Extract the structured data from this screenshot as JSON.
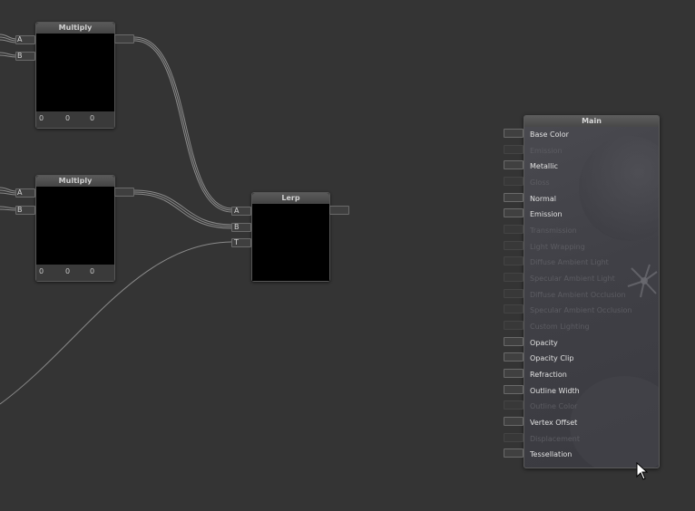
{
  "nodes": {
    "multiply1": {
      "title": "Multiply",
      "inputs": [
        "A",
        "B"
      ],
      "values": [
        "0",
        "0",
        "0"
      ]
    },
    "multiply2": {
      "title": "Multiply",
      "inputs": [
        "A",
        "B"
      ],
      "values": [
        "0",
        "0",
        "0"
      ]
    },
    "lerp": {
      "title": "Lerp",
      "inputs": [
        "A",
        "B",
        "T"
      ]
    }
  },
  "main": {
    "title": "Main",
    "inputs": [
      {
        "label": "Base Color",
        "active": true
      },
      {
        "label": "Emission",
        "active": false
      },
      {
        "label": "Metallic",
        "active": true
      },
      {
        "label": "Gloss",
        "active": false
      },
      {
        "label": "Normal",
        "active": true
      },
      {
        "label": "Emission",
        "active": true
      },
      {
        "label": "Transmission",
        "active": false
      },
      {
        "label": "Light Wrapping",
        "active": false
      },
      {
        "label": "Diffuse Ambient Light",
        "active": false
      },
      {
        "label": "Specular Ambient Light",
        "active": false
      },
      {
        "label": "Diffuse Ambient Occlusion",
        "active": false
      },
      {
        "label": "Specular Ambient Occlusion",
        "active": false
      },
      {
        "label": "Custom Lighting",
        "active": false
      },
      {
        "label": "Opacity",
        "active": true
      },
      {
        "label": "Opacity Clip",
        "active": true
      },
      {
        "label": "Refraction",
        "active": true
      },
      {
        "label": "Outline Width",
        "active": true
      },
      {
        "label": "Outline Color",
        "active": false
      },
      {
        "label": "Vertex Offset",
        "active": true
      },
      {
        "label": "Displacement",
        "active": false
      },
      {
        "label": "Tessellation",
        "active": true
      }
    ]
  },
  "colors": {
    "canvas": "#343434",
    "wire": "#8e8e8e",
    "preview": "#000000",
    "active_text": "#e2e2e2",
    "inactive_text": "#5c5c62"
  },
  "icons": {
    "cursor": "mouse-pointer-icon"
  }
}
